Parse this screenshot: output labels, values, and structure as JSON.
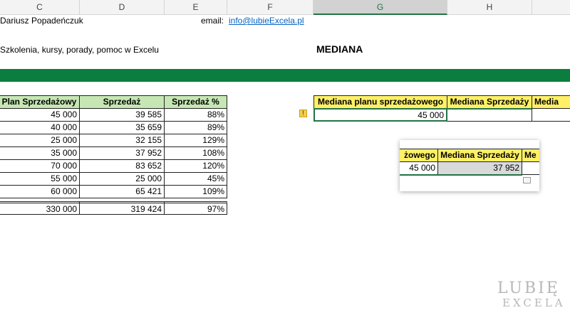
{
  "columns": [
    "C",
    "D",
    "E",
    "F",
    "G",
    "H"
  ],
  "selected_column": "G",
  "author": "Dariusz Popadeńczuk",
  "email_label": "email:",
  "email_link": "info@lubieExcela.pl",
  "tagline": "Szkolenia, kursy, porady, pomoc w Excelu",
  "sheet_title": "MEDIANA",
  "table": {
    "headers": [
      "Plan Sprzedażowy",
      "Sprzedaż",
      "Sprzedaż %"
    ],
    "rows": [
      [
        "45 000",
        "39 585",
        "88%"
      ],
      [
        "40 000",
        "35 659",
        "89%"
      ],
      [
        "25 000",
        "32 155",
        "129%"
      ],
      [
        "35 000",
        "37 952",
        "108%"
      ],
      [
        "70 000",
        "83 652",
        "120%"
      ],
      [
        "55 000",
        "25 000",
        "45%"
      ],
      [
        "60 000",
        "65 421",
        "109%"
      ]
    ],
    "total": [
      "330 000",
      "319 424",
      "97%"
    ]
  },
  "median_table": {
    "headers": [
      "Mediana planu sprzedażowego",
      "Mediana Sprzedaży",
      "Media"
    ],
    "values": [
      "45 000",
      "",
      ""
    ]
  },
  "popup": {
    "headers": [
      "żowego",
      "Mediana Sprzedaży",
      "Me"
    ],
    "values": [
      "45 000",
      "37 952"
    ]
  },
  "warning_glyph": "!",
  "logo": {
    "line1": "LUBIĘ",
    "line2": "EXCELA"
  },
  "colors": {
    "green_band": "#0b7d3e",
    "header_green": "#c6e7b4",
    "header_yellow": "#fff067",
    "selection": "#217346"
  }
}
